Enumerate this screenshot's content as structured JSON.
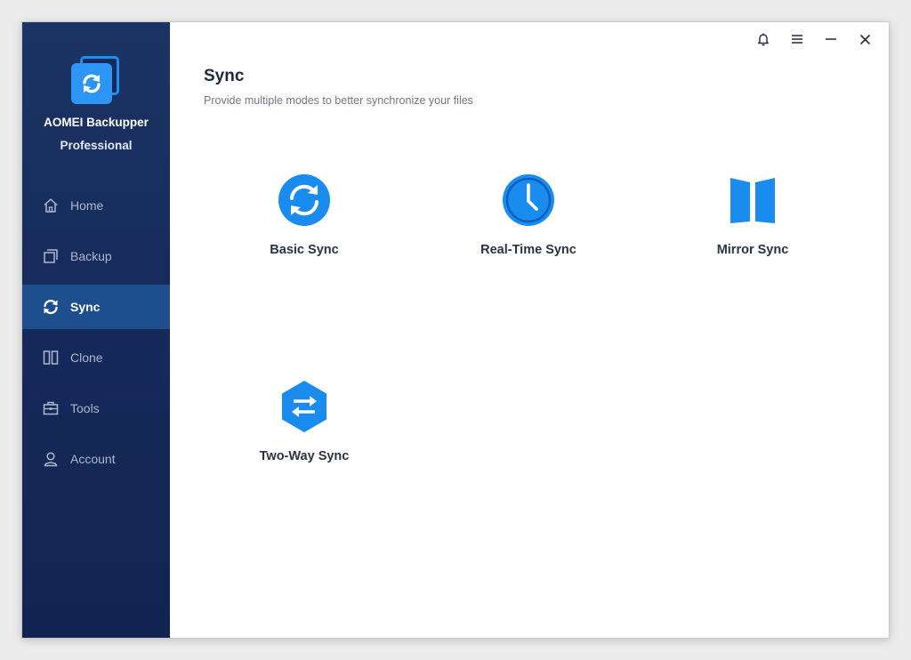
{
  "app": {
    "name": "AOMEI Backupper",
    "edition": "Professional"
  },
  "sidebar": {
    "items": [
      {
        "label": "Home",
        "icon": "home-icon",
        "active": false
      },
      {
        "label": "Backup",
        "icon": "backup-icon",
        "active": false
      },
      {
        "label": "Sync",
        "icon": "sync-icon",
        "active": true
      },
      {
        "label": "Clone",
        "icon": "clone-icon",
        "active": false
      },
      {
        "label": "Tools",
        "icon": "toolbox-icon",
        "active": false
      },
      {
        "label": "Account",
        "icon": "user-icon",
        "active": false
      }
    ]
  },
  "titlebar": {
    "buttons": [
      "bell-icon",
      "menu-icon",
      "minimize-icon",
      "close-icon"
    ]
  },
  "main": {
    "title": "Sync",
    "subtitle": "Provide multiple modes to better synchronize your files",
    "options": [
      {
        "label": "Basic Sync",
        "icon": "basic-sync-icon"
      },
      {
        "label": "Real-Time Sync",
        "icon": "clock-icon"
      },
      {
        "label": "Mirror Sync",
        "icon": "mirror-icon"
      },
      {
        "label": "Two-Way Sync",
        "icon": "two-way-arrows-icon"
      }
    ]
  },
  "colors": {
    "sidebar_bg": "#15295a",
    "sidebar_active": "#1f4e8e",
    "accent": "#1a8cf0",
    "text_dark": "#1e2a3d"
  }
}
